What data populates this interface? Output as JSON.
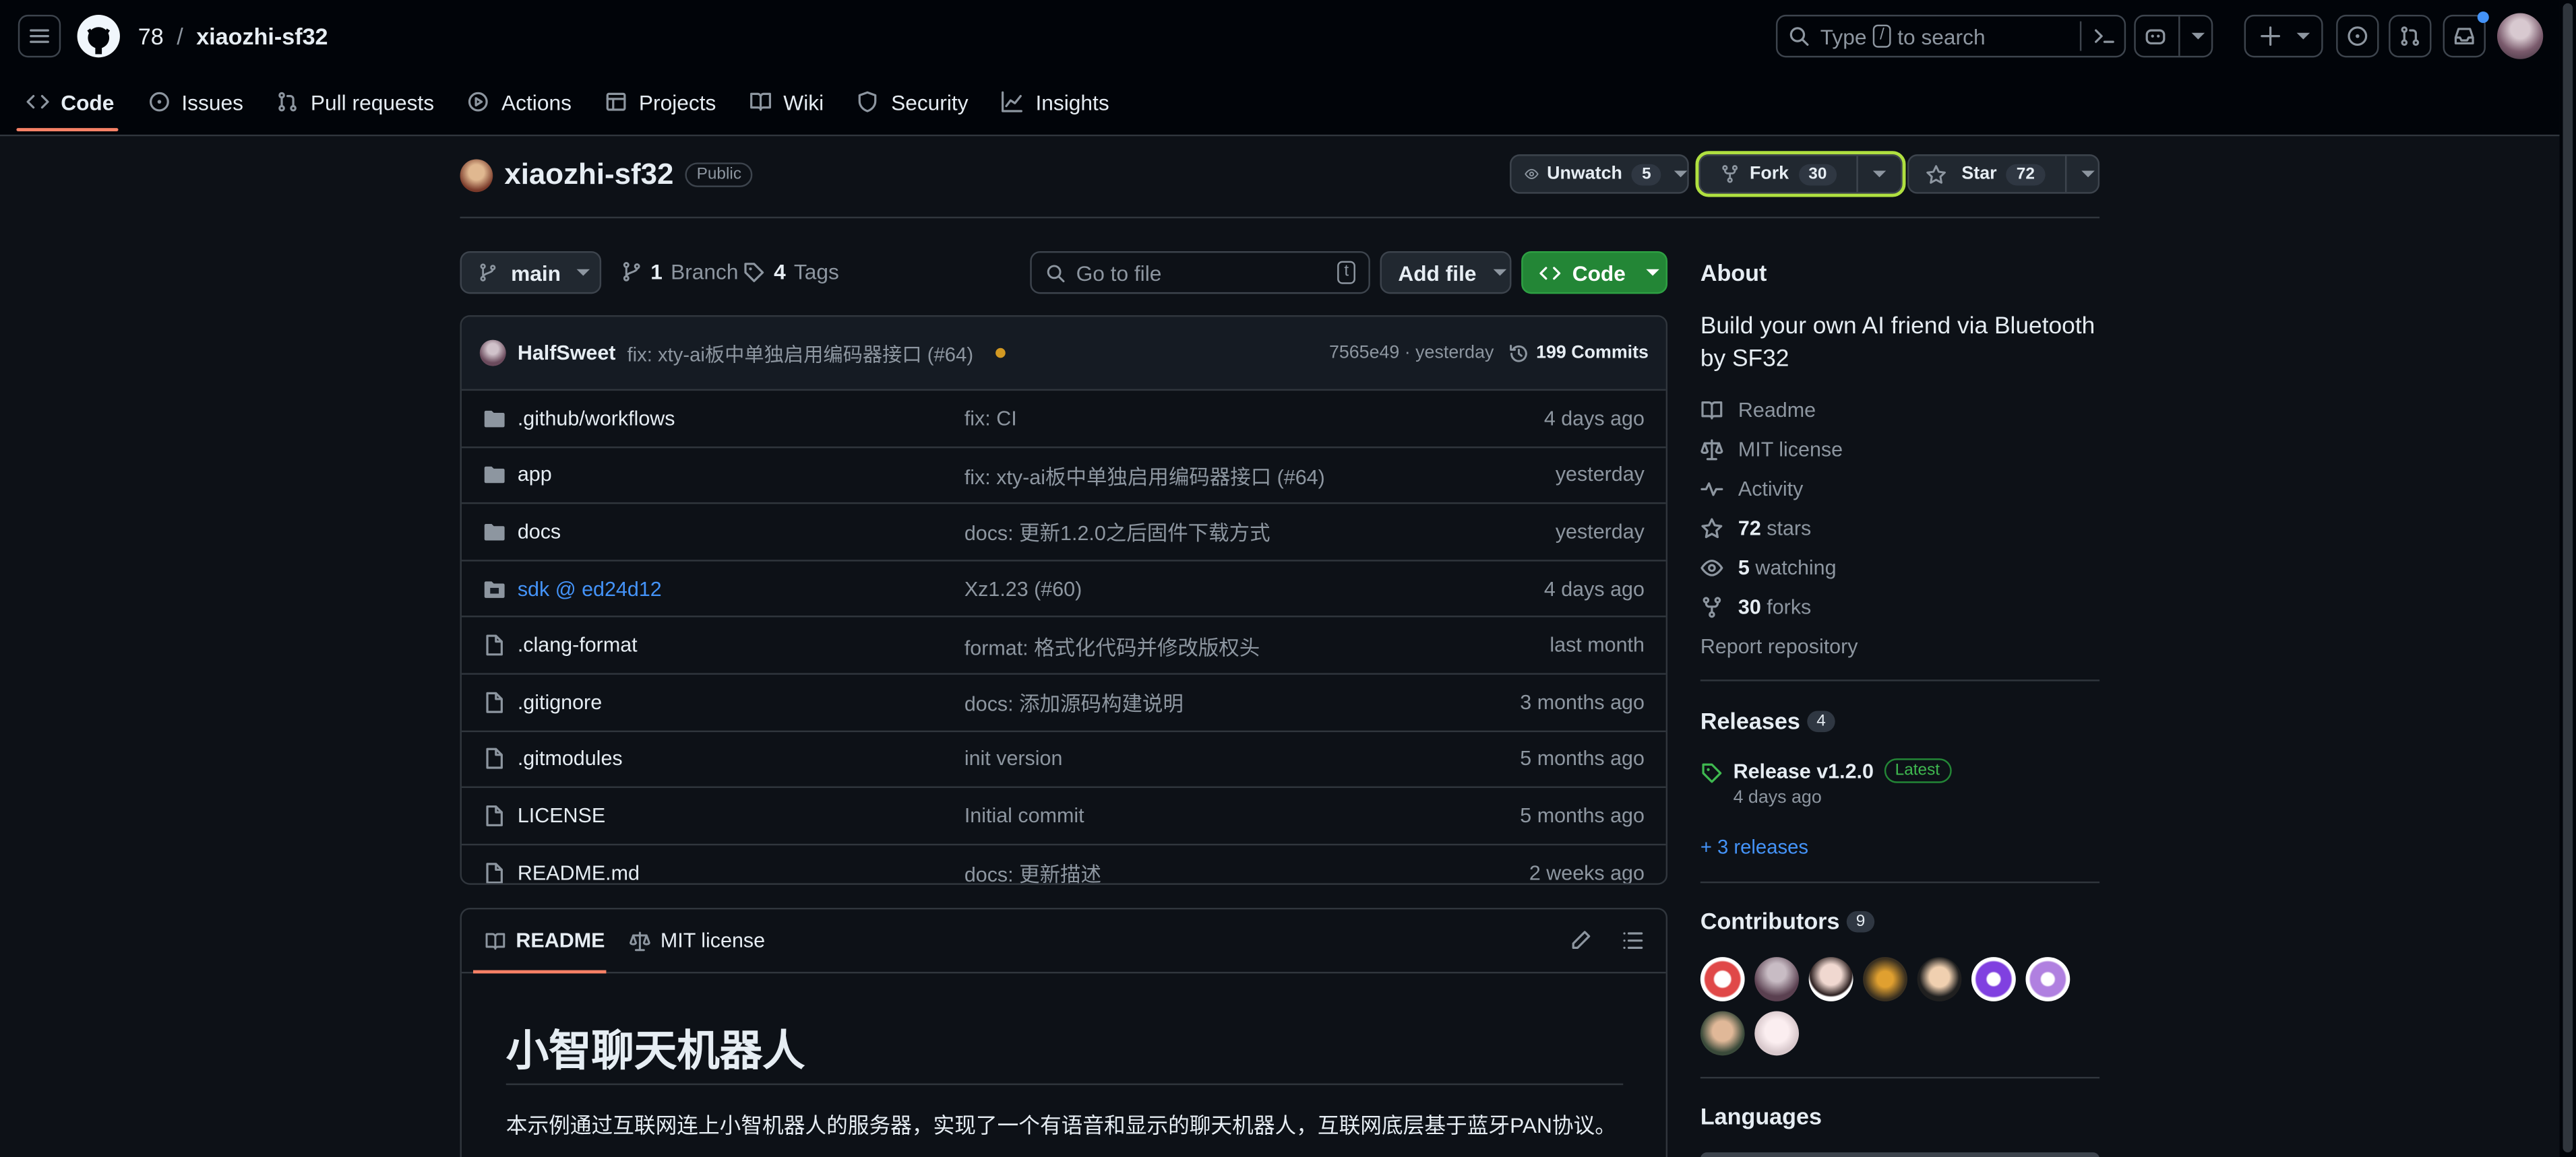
{
  "header": {
    "owner": "78",
    "repo": "xiaozhi-sf32",
    "search_pre": "Type",
    "search_key": "/",
    "search_post": "to search"
  },
  "nav": [
    {
      "label": "Code",
      "icon": "code-icon"
    },
    {
      "label": "Issues",
      "icon": "issue-opened-icon"
    },
    {
      "label": "Pull requests",
      "icon": "git-pull-request-icon"
    },
    {
      "label": "Actions",
      "icon": "play-icon"
    },
    {
      "label": "Projects",
      "icon": "table-icon"
    },
    {
      "label": "Wiki",
      "icon": "book-icon"
    },
    {
      "label": "Security",
      "icon": "shield-icon"
    },
    {
      "label": "Insights",
      "icon": "graph-icon"
    }
  ],
  "repo": {
    "name": "xiaozhi-sf32",
    "visibility": "Public",
    "unwatch_label": "Unwatch",
    "watch_count": "5",
    "fork_label": "Fork",
    "fork_count": "30",
    "star_label": "Star",
    "star_count": "72"
  },
  "toolbar": {
    "branch": "main",
    "branches_count": "1",
    "branches_label": "Branch",
    "tags_count": "4",
    "tags_label": "Tags",
    "goto_placeholder": "Go to file",
    "goto_key": "t",
    "add_file": "Add file",
    "code": "Code"
  },
  "commit": {
    "author": "HalfSweet",
    "message": "fix: xty-ai板中单独启用编码器接口 (#64)",
    "hash_time": "7565e49 · yesterday",
    "commits_label": "199 Commits"
  },
  "files": [
    {
      "name": ".github/workflows",
      "type": "folder",
      "message": "fix: CI",
      "age": "4 days ago"
    },
    {
      "name": "app",
      "type": "folder",
      "message": "fix: xty-ai板中单独启用编码器接口 (#64)",
      "age": "yesterday"
    },
    {
      "name": "docs",
      "type": "folder",
      "message": "docs: 更新1.2.0之后固件下载方式",
      "age": "yesterday"
    },
    {
      "name": "sdk @ ed24d12",
      "type": "submodule",
      "message": "Xz1.23 (#60)",
      "age": "4 days ago"
    },
    {
      "name": ".clang-format",
      "type": "file",
      "message": "format: 格式化代码并修改版权头",
      "age": "last month"
    },
    {
      "name": ".gitignore",
      "type": "file",
      "message": "docs: 添加源码构建说明",
      "age": "3 months ago"
    },
    {
      "name": ".gitmodules",
      "type": "file",
      "message": "init version",
      "age": "5 months ago"
    },
    {
      "name": "LICENSE",
      "type": "file",
      "message": "Initial commit",
      "age": "5 months ago"
    },
    {
      "name": "README.md",
      "type": "file",
      "message": "docs: 更新描述",
      "age": "2 weeks ago"
    }
  ],
  "readme": {
    "tab_readme": "README",
    "tab_license": "MIT license",
    "title": "小智聊天机器人",
    "paragraph": "本示例通过互联网连上小智机器人的服务器，实现了一个有语音和显示的聊天机器人，互联网底层基于蓝牙PAN协议。"
  },
  "about": {
    "heading": "About",
    "description": "Build your own AI friend via Bluetooth by SF32",
    "readme": "Readme",
    "license": "MIT license",
    "activity": "Activity",
    "stars_count": "72",
    "stars_label": "stars",
    "watching_count": "5",
    "watching_label": "watching",
    "forks_count": "30",
    "forks_label": "forks",
    "report": "Report repository"
  },
  "releases": {
    "heading": "Releases",
    "count": "4",
    "name": "Release v1.2.0",
    "badge": "Latest",
    "date": "4 days ago",
    "more": "+ 3 releases"
  },
  "contributors": {
    "heading": "Contributors",
    "count": "9"
  },
  "languages": {
    "heading": "Languages"
  },
  "colors": {
    "accent_green": "#238636",
    "link": "#4493f8",
    "tab_underline": "#f78166",
    "fork_highlight": "#b0e040"
  }
}
